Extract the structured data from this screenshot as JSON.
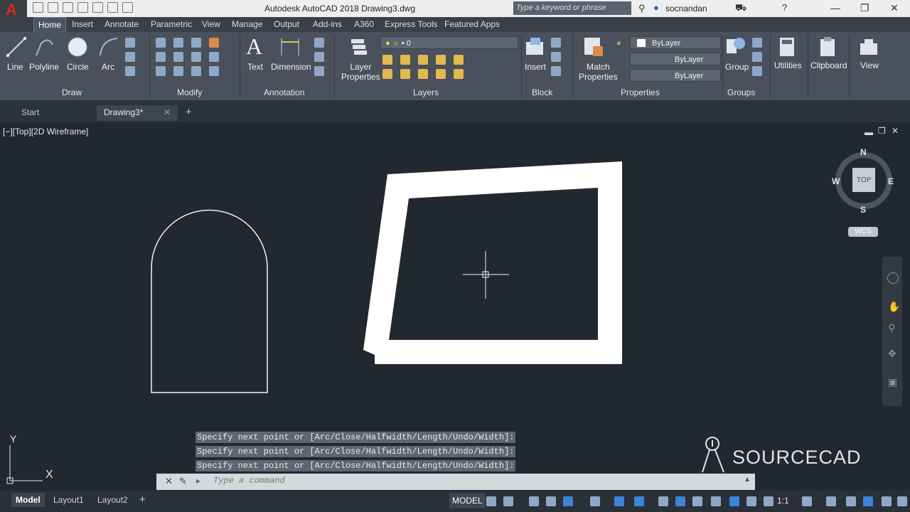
{
  "app": {
    "title": "Autodesk AutoCAD 2018    Drawing3.dwg",
    "logo_letter": "A",
    "search_placeholder": "Type a keyword or phrase",
    "user": "socnandan"
  },
  "menu_tabs": [
    "Home",
    "Insert",
    "Annotate",
    "Parametric",
    "View",
    "Manage",
    "Output",
    "Add-ins",
    "A360",
    "Express Tools",
    "Featured Apps"
  ],
  "ribbon": {
    "draw": {
      "line": "Line",
      "polyline": "Polyline",
      "circle": "Circle",
      "arc": "Arc",
      "panel": "Draw"
    },
    "modify": {
      "panel": "Modify"
    },
    "annotation": {
      "text": "Text",
      "dimension": "Dimension",
      "panel": "Annotation"
    },
    "layers": {
      "layer_properties_1": "Layer",
      "layer_properties_2": "Properties",
      "current_layer": "0",
      "panel": "Layers"
    },
    "block": {
      "insert": "Insert",
      "panel": "Block"
    },
    "properties": {
      "match_1": "Match",
      "match_2": "Properties",
      "color": "ByLayer",
      "linetype": "ByLayer",
      "lineweight": "ByLayer",
      "panel": "Properties"
    },
    "groups": {
      "group": "Group",
      "panel": "Groups"
    },
    "utilities": "Utilities",
    "clipboard": "Clipboard",
    "view": "View"
  },
  "file_tabs": {
    "start": "Start",
    "drawing": "Drawing3*"
  },
  "viewport": {
    "label": "[−][Top][2D Wireframe]",
    "viewcube": {
      "n": "N",
      "s": "S",
      "e": "E",
      "w": "W",
      "face": "TOP",
      "wcs": "WCS"
    },
    "ucs_x": "X",
    "ucs_y": "Y"
  },
  "command": {
    "history": [
      "Specify next point or [Arc/Close/Halfwidth/Length/Undo/Width]:",
      "Specify next point or [Arc/Close/Halfwidth/Length/Undo/Width]:",
      "Specify next point or [Arc/Close/Halfwidth/Length/Undo/Width]:"
    ],
    "placeholder": "Type a command"
  },
  "status": {
    "layouts": [
      "Model",
      "Layout1",
      "Layout2"
    ],
    "model_space": "MODEL",
    "scale": "1:1"
  },
  "watermark": "SOURCECAD",
  "colors": {
    "background": "#212830",
    "ribbon": "#4a515c",
    "accent_red": "#e1251b"
  }
}
